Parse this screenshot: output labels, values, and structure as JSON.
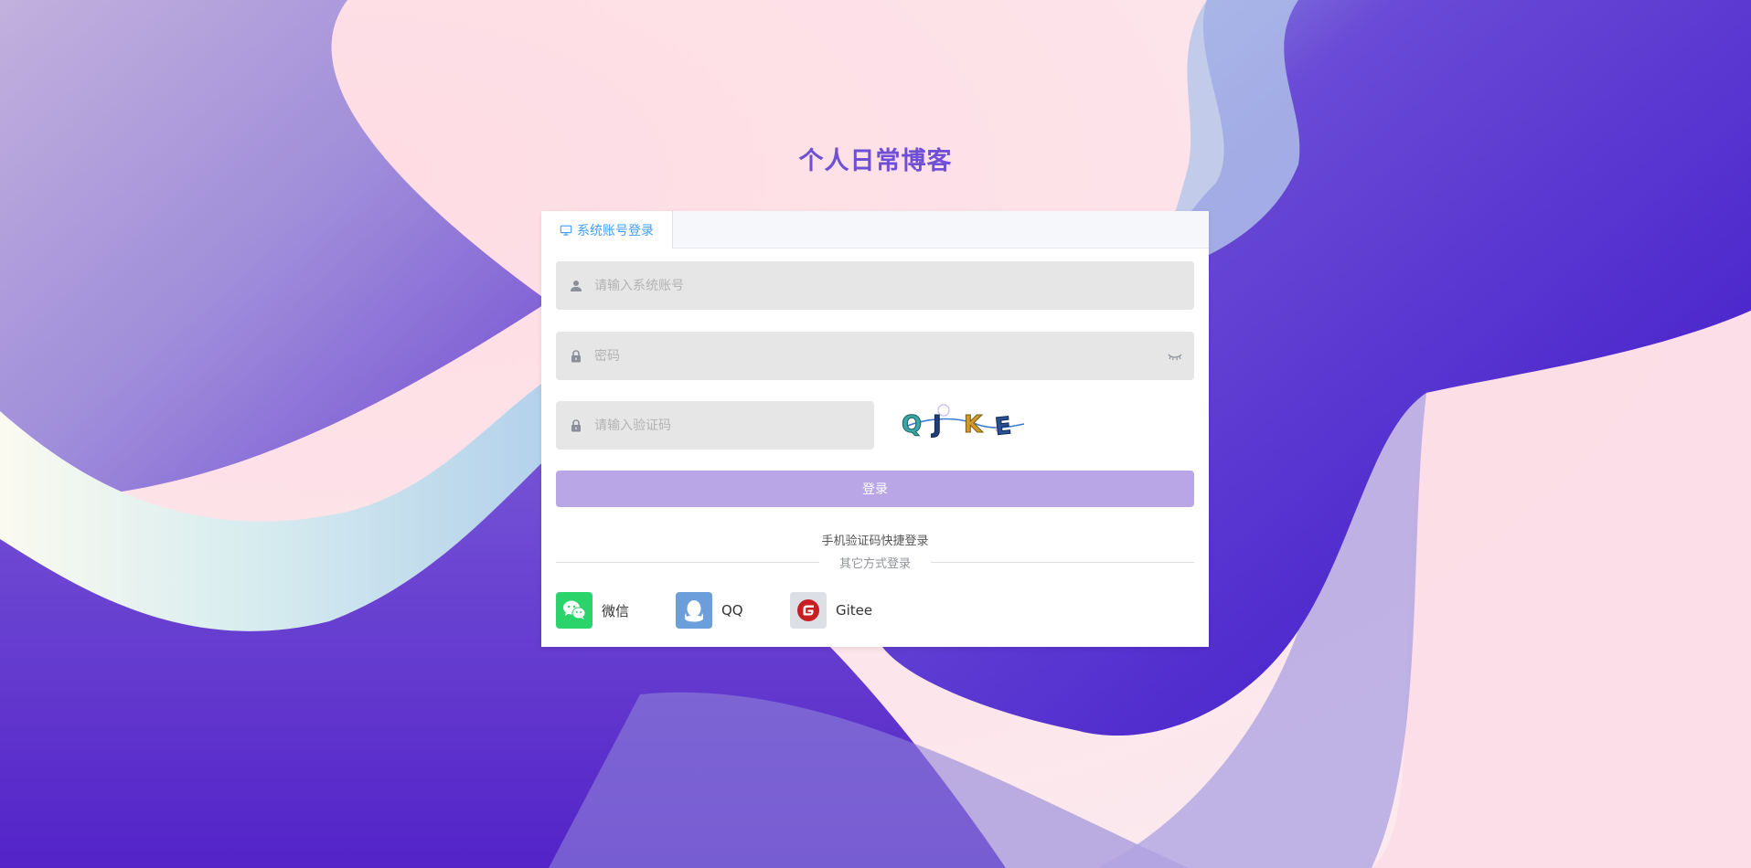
{
  "page": {
    "title": "个人日常博客"
  },
  "login_card": {
    "tabs": [
      {
        "label": "系统账号登录",
        "icon": "monitor-icon",
        "active": true
      }
    ],
    "username": {
      "placeholder": "请输入系统账号",
      "value": "",
      "icon": "user-icon"
    },
    "password": {
      "placeholder": "密码",
      "value": "",
      "icon": "lock-icon",
      "toggle_icon": "eye-closed-icon"
    },
    "captcha": {
      "placeholder": "请输入验证码",
      "value": "",
      "icon": "lock-icon",
      "image_text": "QJKE"
    },
    "login_button": "登录",
    "sms_login_link": "手机验证码快捷登录",
    "other_methods_label": "其它方式登录",
    "social": [
      {
        "label": "微信",
        "icon": "wechat-icon",
        "color": "#2bd36b"
      },
      {
        "label": "QQ",
        "icon": "qq-icon",
        "color": "#6b9edb"
      },
      {
        "label": "Gitee",
        "icon": "gitee-icon",
        "color": "#c71d23"
      }
    ]
  },
  "colors": {
    "accent": "#6f4fd6",
    "tab_active": "#409eff",
    "button": "#b8a6e6",
    "input_bg": "#e6e6e6"
  }
}
